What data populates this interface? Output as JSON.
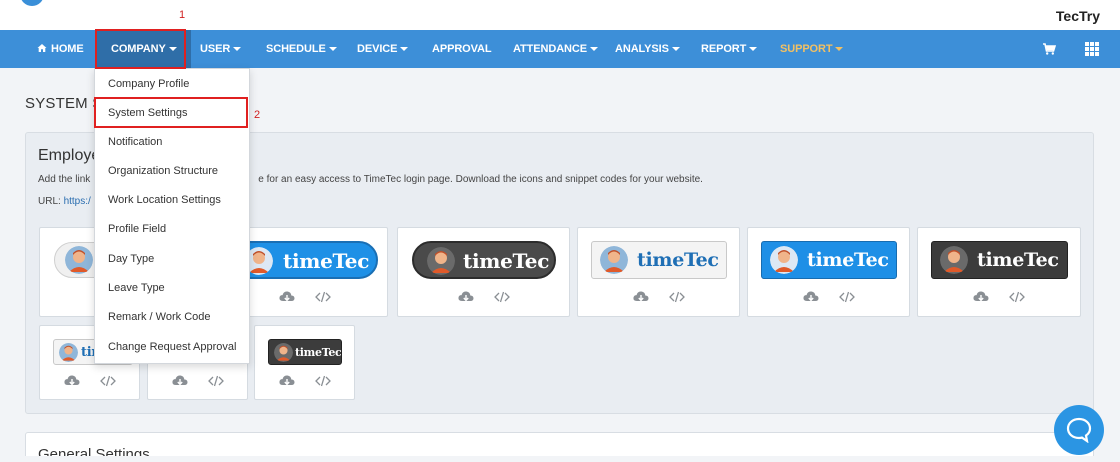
{
  "header": {
    "user_name": "TecTry"
  },
  "nav": {
    "home": "HOME",
    "company": "COMPANY",
    "user": "USER",
    "schedule": "SCHEDULE",
    "device": "DEVICE",
    "approval": "APPROVAL",
    "attendance": "ATTENDANCE",
    "analysis": "ANALYSIS",
    "report": "REPORT",
    "support": "SUPPORT"
  },
  "company_menu": {
    "items": [
      "Company Profile",
      "System Settings",
      "Notification",
      "Organization Structure",
      "Work Location Settings",
      "Profile Field",
      "Day Type",
      "Leave Type",
      "Remark / Work Code",
      "Change Request Approval"
    ]
  },
  "annotations": {
    "step1": "1",
    "step2": "2"
  },
  "page": {
    "title": "SYSTEM S"
  },
  "employee_panel": {
    "title": "Employe",
    "desc_start": "Add the link",
    "desc_end": "e for an easy access to TimeTec login page. Download the icons and snippet codes for your website.",
    "url_label": "URL: ",
    "url_value": "https:/"
  },
  "badges": {
    "brand": "timeTec",
    "short": "tim"
  },
  "general_settings": {
    "title": "General Settings"
  },
  "colors": {
    "nav_bg": "#3d8fd8",
    "nav_active": "#2f6ea8",
    "support": "#f2c063",
    "highlight": "#e02020",
    "link": "#2a6db0",
    "chat": "#2b95e3"
  },
  "icons": [
    "home-icon",
    "cart-icon",
    "apps-grid-icon",
    "cloud-download-icon",
    "code-icon",
    "chat-icon"
  ]
}
